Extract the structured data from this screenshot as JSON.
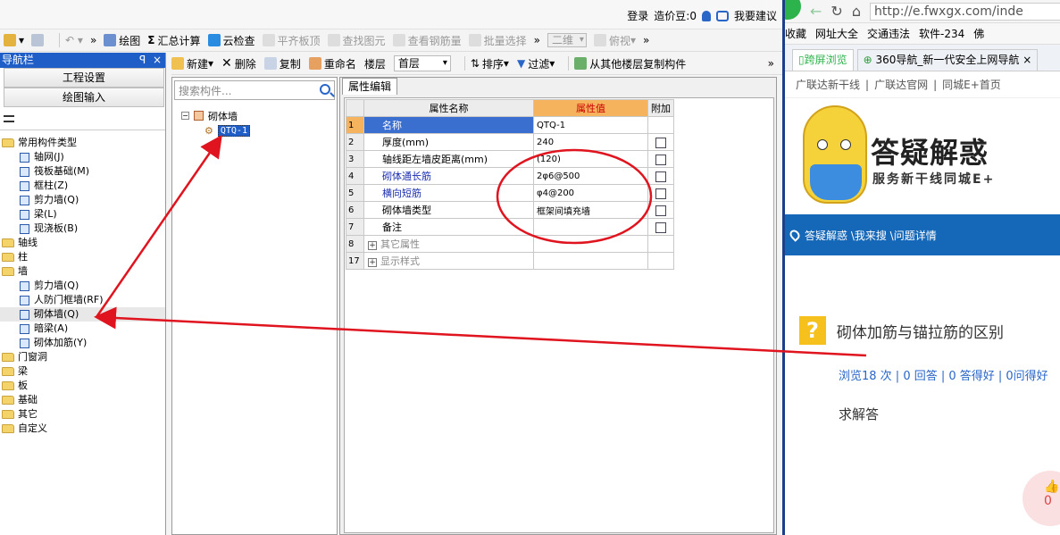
{
  "top": {
    "login": "登录",
    "price_beans": "造价豆:0",
    "suggest": "我要建议"
  },
  "toolbar1": {
    "draw": "绘图",
    "summary": "汇总计算",
    "cloud_check": "云检查",
    "flat_top": "平齐板顶",
    "find_element": "查找图元",
    "view_rebar": "查看钢筋量",
    "batch_select": "批量选择",
    "view_mode": "二维",
    "view_angle": "俯视",
    "overflow": "»"
  },
  "nav": {
    "title": "导航栏",
    "pin": "ꟼ",
    "close": "×",
    "project_settings": "工程设置",
    "drawing_input": "绘图输入",
    "tree": [
      {
        "label": "常用构件类型",
        "level": 1,
        "type": "folder"
      },
      {
        "label": "轴网(J)",
        "level": 2,
        "type": "leaf"
      },
      {
        "label": "筏板基础(M)",
        "level": 2,
        "type": "leaf"
      },
      {
        "label": "框柱(Z)",
        "level": 2,
        "type": "leaf"
      },
      {
        "label": "剪力墙(Q)",
        "level": 2,
        "type": "leaf"
      },
      {
        "label": "梁(L)",
        "level": 2,
        "type": "leaf"
      },
      {
        "label": "现浇板(B)",
        "level": 2,
        "type": "leaf"
      },
      {
        "label": "轴线",
        "level": 1,
        "type": "folder"
      },
      {
        "label": "柱",
        "level": 1,
        "type": "folder"
      },
      {
        "label": "墙",
        "level": 1,
        "type": "folder"
      },
      {
        "label": "剪力墙(Q)",
        "level": 2,
        "type": "leaf"
      },
      {
        "label": "人防门框墙(RF)",
        "level": 2,
        "type": "leaf"
      },
      {
        "label": "砌体墙(Q)",
        "level": 2,
        "type": "leaf",
        "selected": true
      },
      {
        "label": "暗梁(A)",
        "level": 2,
        "type": "leaf"
      },
      {
        "label": "砌体加筋(Y)",
        "level": 2,
        "type": "leaf"
      },
      {
        "label": "门窗洞",
        "level": 1,
        "type": "folder"
      },
      {
        "label": "梁",
        "level": 1,
        "type": "folder"
      },
      {
        "label": "板",
        "level": 1,
        "type": "folder"
      },
      {
        "label": "基础",
        "level": 1,
        "type": "folder"
      },
      {
        "label": "其它",
        "level": 1,
        "type": "folder"
      },
      {
        "label": "自定义",
        "level": 1,
        "type": "folder"
      }
    ]
  },
  "toolbar2": {
    "new": "新建",
    "delete": "删除",
    "copy": "复制",
    "rename": "重命名",
    "floor_label": "楼层",
    "floor_value": "首层",
    "sort": "排序",
    "filter": "过滤",
    "copy_from_floor": "从其他楼层复制构件",
    "overflow": "»"
  },
  "components": {
    "search_placeholder": "搜索构件...",
    "group": "砌体墙",
    "item": "QTQ-1"
  },
  "props": {
    "tab": "属性编辑",
    "col_name": "属性名称",
    "col_value": "属性值",
    "col_add": "附加",
    "rows": [
      {
        "num": "1",
        "name": "名称",
        "value": "QTQ-1",
        "checkbox": false,
        "style": "sel"
      },
      {
        "num": "2",
        "name": "厚度(mm)",
        "value": "240",
        "checkbox": true,
        "style": ""
      },
      {
        "num": "3",
        "name": "轴线距左墙皮距离(mm)",
        "value": "(120)",
        "checkbox": true,
        "style": ""
      },
      {
        "num": "4",
        "name": "砌体通长筋",
        "value": "2φ6@500",
        "checkbox": true,
        "style": "blue"
      },
      {
        "num": "5",
        "name": "横向短筋",
        "value": "φ4@200",
        "checkbox": true,
        "style": "blue"
      },
      {
        "num": "6",
        "name": "砌体墙类型",
        "value": "框架间填充墙",
        "checkbox": true,
        "style": ""
      },
      {
        "num": "7",
        "name": "备注",
        "value": "",
        "checkbox": true,
        "style": ""
      },
      {
        "num": "8",
        "name": "其它属性",
        "value": "",
        "checkbox": false,
        "style": "group"
      },
      {
        "num": "17",
        "name": "显示样式",
        "value": "",
        "checkbox": false,
        "style": "group"
      }
    ]
  },
  "browser": {
    "address": "http://e.fwxgx.com/inde",
    "fav": [
      "收藏",
      "网址大全",
      "交通违法",
      "软件-234",
      "佛"
    ],
    "tabs": [
      "跨屏浏览",
      "360导航_新一代安全上网导航"
    ],
    "tab_close": "×",
    "links": [
      "广联达新干线",
      "广联达官网",
      "同城E+首页"
    ],
    "hero_title": "答疑解惑",
    "hero_sub": "服务新干线同城E+",
    "crumb": "答疑解惑 \\我来搜 \\问题详情",
    "question_title": "砌体加筋与锚拉筋的区别",
    "stats": "浏览18 次 | 0 回答 | 0 答得好 | 0问得好",
    "ask": "求解答",
    "like_count": "0",
    "colors": {
      "brand_blue": "#1567b8",
      "accent_yellow": "#f6c11c"
    }
  },
  "annotation": {
    "color": "#e0141e"
  }
}
